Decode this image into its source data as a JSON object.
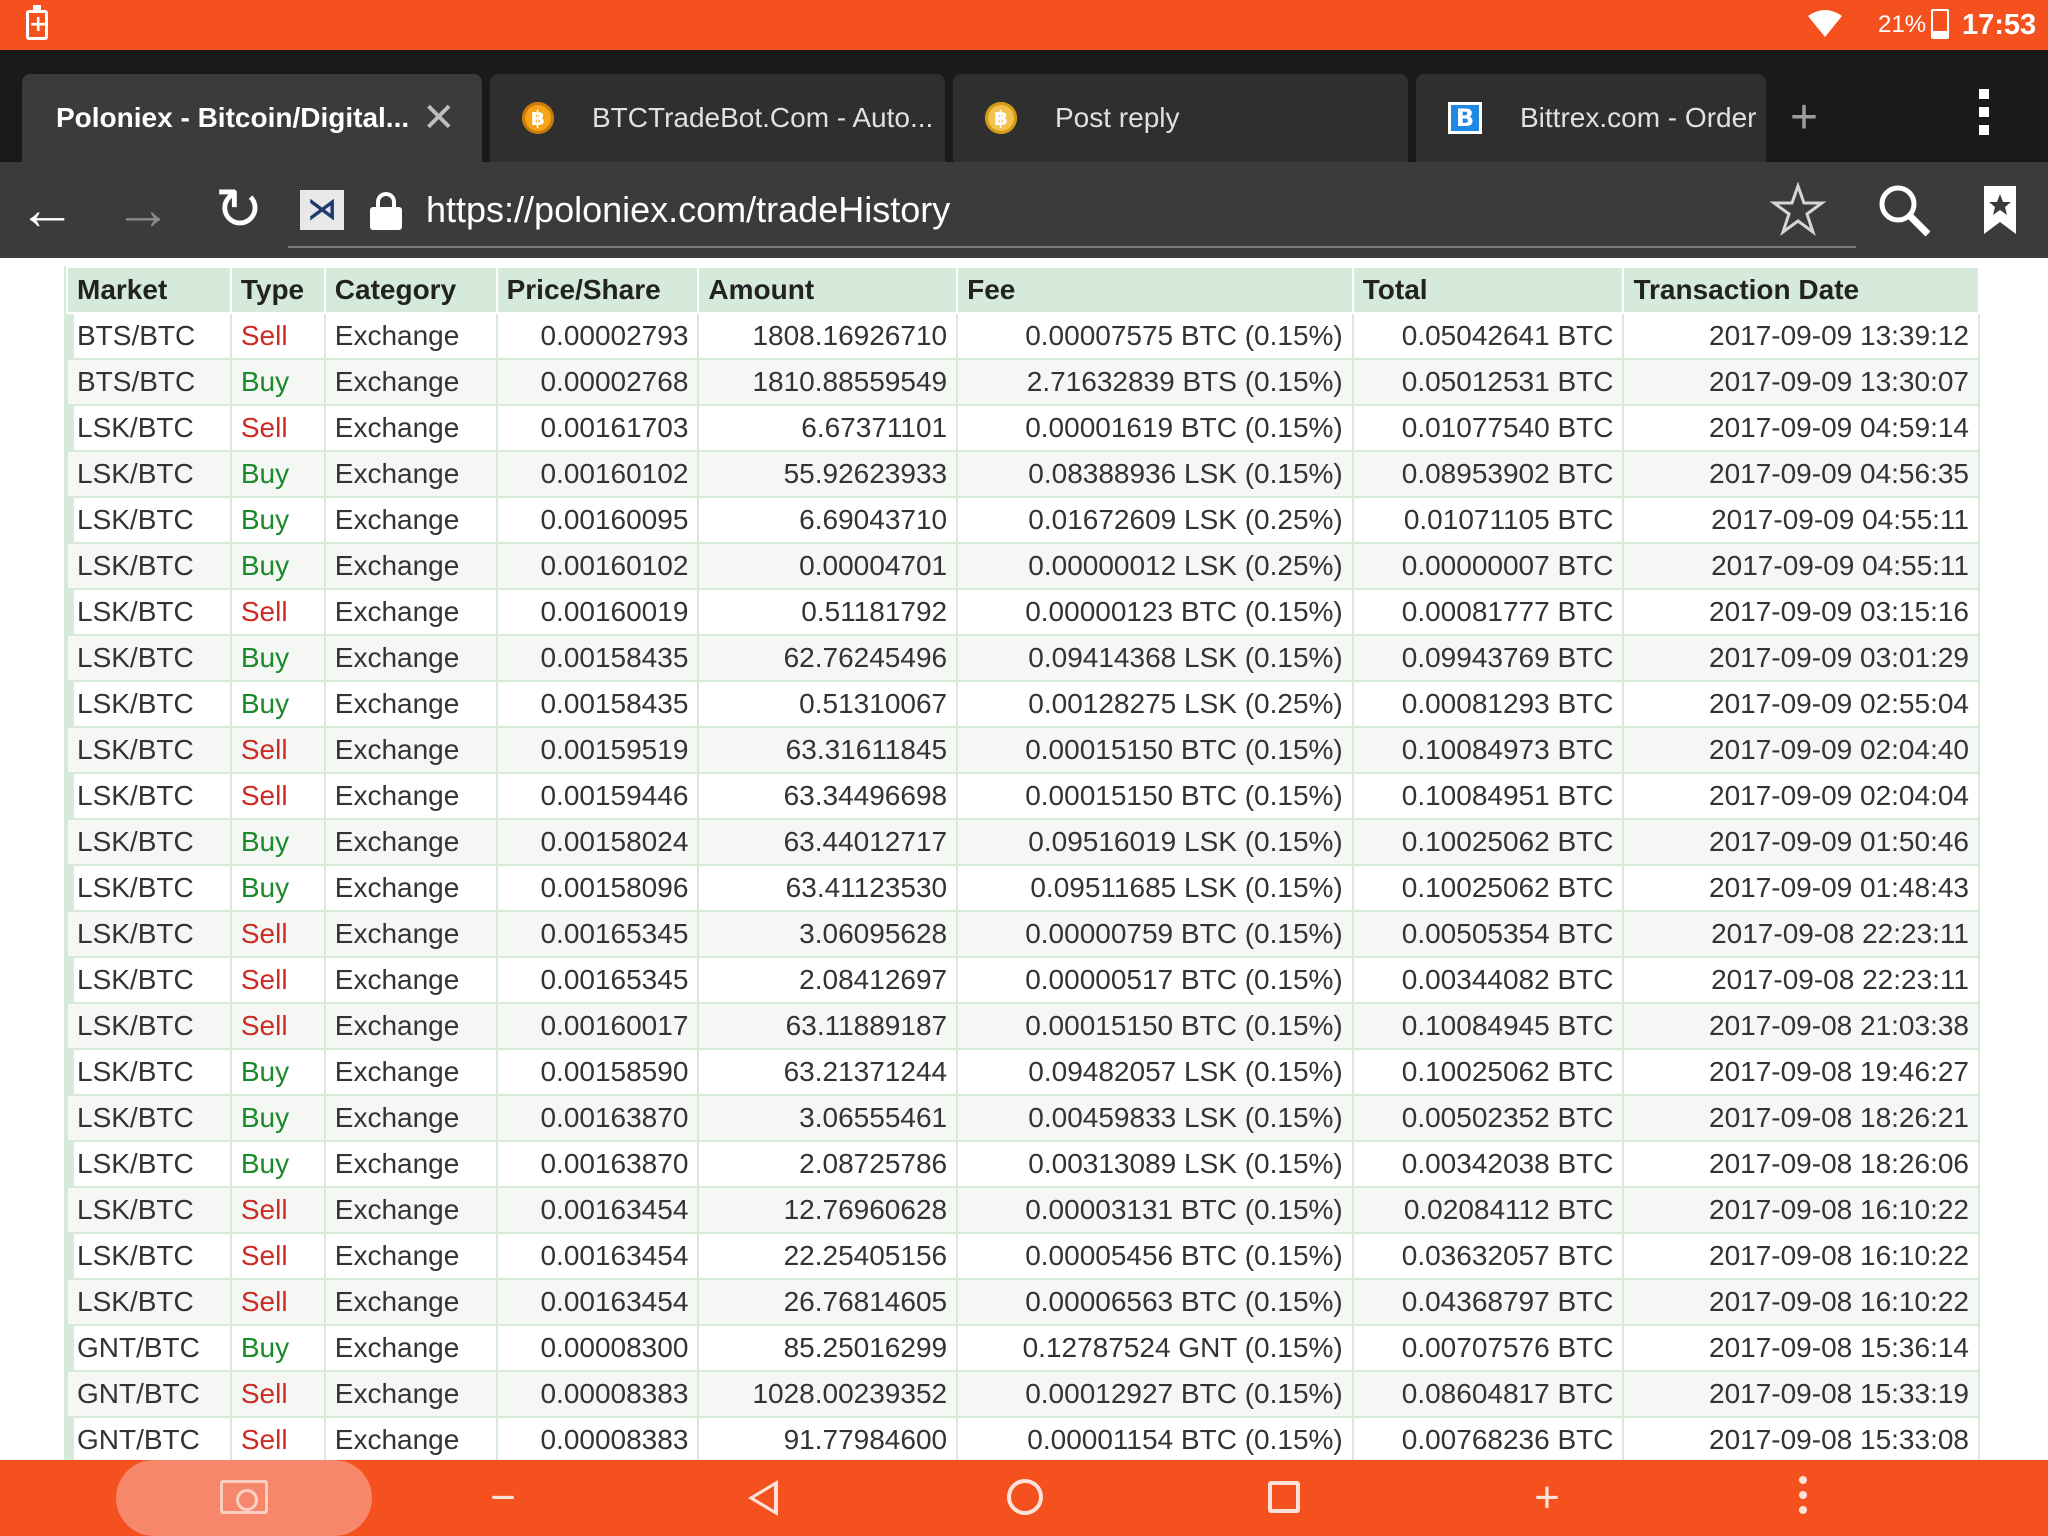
{
  "status_bar": {
    "battery_percent": "21%",
    "time": "17:53",
    "icons": [
      "battery-alert-icon",
      "wifi-icon",
      "battery-icon"
    ]
  },
  "tabs": [
    {
      "title": "Poloniex - Bitcoin/Digital...",
      "active": true,
      "close": "✕"
    },
    {
      "title": "BTCTradeBot.Com - Auto...",
      "favicon": "bitcoin-coin-icon"
    },
    {
      "title": "Post reply",
      "favicon": "bitcoin-coin-icon"
    },
    {
      "title": "Bittrex.com - Order I",
      "favicon": "bittrex-b-icon",
      "favicon_text": "B"
    }
  ],
  "toolbar": {
    "back": "←",
    "forward": "→",
    "reload": "↻",
    "site_icon_text": "⋊",
    "url": "https://poloniex.com/tradeHistory",
    "new_tab": "+"
  },
  "table": {
    "headers": [
      "Market",
      "Type",
      "Category",
      "Price/Share",
      "Amount",
      "Fee",
      "Total",
      "Transaction Date"
    ],
    "rows": [
      [
        "BTS/BTC",
        "Sell",
        "Exchange",
        "0.00002793",
        "1808.16926710",
        "0.00007575 BTC (0.15%)",
        "0.05042641 BTC",
        "2017-09-09 13:39:12"
      ],
      [
        "BTS/BTC",
        "Buy",
        "Exchange",
        "0.00002768",
        "1810.88559549",
        "2.71632839 BTS (0.15%)",
        "0.05012531 BTC",
        "2017-09-09 13:30:07"
      ],
      [
        "LSK/BTC",
        "Sell",
        "Exchange",
        "0.00161703",
        "6.67371101",
        "0.00001619 BTC (0.15%)",
        "0.01077540 BTC",
        "2017-09-09 04:59:14"
      ],
      [
        "LSK/BTC",
        "Buy",
        "Exchange",
        "0.00160102",
        "55.92623933",
        "0.08388936 LSK (0.15%)",
        "0.08953902 BTC",
        "2017-09-09 04:56:35"
      ],
      [
        "LSK/BTC",
        "Buy",
        "Exchange",
        "0.00160095",
        "6.69043710",
        "0.01672609 LSK (0.25%)",
        "0.01071105 BTC",
        "2017-09-09 04:55:11"
      ],
      [
        "LSK/BTC",
        "Buy",
        "Exchange",
        "0.00160102",
        "0.00004701",
        "0.00000012 LSK (0.25%)",
        "0.00000007 BTC",
        "2017-09-09 04:55:11"
      ],
      [
        "LSK/BTC",
        "Sell",
        "Exchange",
        "0.00160019",
        "0.51181792",
        "0.00000123 BTC (0.15%)",
        "0.00081777 BTC",
        "2017-09-09 03:15:16"
      ],
      [
        "LSK/BTC",
        "Buy",
        "Exchange",
        "0.00158435",
        "62.76245496",
        "0.09414368 LSK (0.15%)",
        "0.09943769 BTC",
        "2017-09-09 03:01:29"
      ],
      [
        "LSK/BTC",
        "Buy",
        "Exchange",
        "0.00158435",
        "0.51310067",
        "0.00128275 LSK (0.25%)",
        "0.00081293 BTC",
        "2017-09-09 02:55:04"
      ],
      [
        "LSK/BTC",
        "Sell",
        "Exchange",
        "0.00159519",
        "63.31611845",
        "0.00015150 BTC (0.15%)",
        "0.10084973 BTC",
        "2017-09-09 02:04:40"
      ],
      [
        "LSK/BTC",
        "Sell",
        "Exchange",
        "0.00159446",
        "63.34496698",
        "0.00015150 BTC (0.15%)",
        "0.10084951 BTC",
        "2017-09-09 02:04:04"
      ],
      [
        "LSK/BTC",
        "Buy",
        "Exchange",
        "0.00158024",
        "63.44012717",
        "0.09516019 LSK (0.15%)",
        "0.10025062 BTC",
        "2017-09-09 01:50:46"
      ],
      [
        "LSK/BTC",
        "Buy",
        "Exchange",
        "0.00158096",
        "63.41123530",
        "0.09511685 LSK (0.15%)",
        "0.10025062 BTC",
        "2017-09-09 01:48:43"
      ],
      [
        "LSK/BTC",
        "Sell",
        "Exchange",
        "0.00165345",
        "3.06095628",
        "0.00000759 BTC (0.15%)",
        "0.00505354 BTC",
        "2017-09-08 22:23:11"
      ],
      [
        "LSK/BTC",
        "Sell",
        "Exchange",
        "0.00165345",
        "2.08412697",
        "0.00000517 BTC (0.15%)",
        "0.00344082 BTC",
        "2017-09-08 22:23:11"
      ],
      [
        "LSK/BTC",
        "Sell",
        "Exchange",
        "0.00160017",
        "63.11889187",
        "0.00015150 BTC (0.15%)",
        "0.10084945 BTC",
        "2017-09-08 21:03:38"
      ],
      [
        "LSK/BTC",
        "Buy",
        "Exchange",
        "0.00158590",
        "63.21371244",
        "0.09482057 LSK (0.15%)",
        "0.10025062 BTC",
        "2017-09-08 19:46:27"
      ],
      [
        "LSK/BTC",
        "Buy",
        "Exchange",
        "0.00163870",
        "3.06555461",
        "0.00459833 LSK (0.15%)",
        "0.00502352 BTC",
        "2017-09-08 18:26:21"
      ],
      [
        "LSK/BTC",
        "Buy",
        "Exchange",
        "0.00163870",
        "2.08725786",
        "0.00313089 LSK (0.15%)",
        "0.00342038 BTC",
        "2017-09-08 18:26:06"
      ],
      [
        "LSK/BTC",
        "Sell",
        "Exchange",
        "0.00163454",
        "12.76960628",
        "0.00003131 BTC (0.15%)",
        "0.02084112 BTC",
        "2017-09-08 16:10:22"
      ],
      [
        "LSK/BTC",
        "Sell",
        "Exchange",
        "0.00163454",
        "22.25405156",
        "0.00005456 BTC (0.15%)",
        "0.03632057 BTC",
        "2017-09-08 16:10:22"
      ],
      [
        "LSK/BTC",
        "Sell",
        "Exchange",
        "0.00163454",
        "26.76814605",
        "0.00006563 BTC (0.15%)",
        "0.04368797 BTC",
        "2017-09-08 16:10:22"
      ],
      [
        "GNT/BTC",
        "Buy",
        "Exchange",
        "0.00008300",
        "85.25016299",
        "0.12787524 GNT (0.15%)",
        "0.00707576 BTC",
        "2017-09-08 15:36:14"
      ],
      [
        "GNT/BTC",
        "Sell",
        "Exchange",
        "0.00008383",
        "1028.00239352",
        "0.00012927 BTC (0.15%)",
        "0.08604817 BTC",
        "2017-09-08 15:33:19"
      ],
      [
        "GNT/BTC",
        "Sell",
        "Exchange",
        "0.00008383",
        "91.77984600",
        "0.00001154 BTC (0.15%)",
        "0.00768236 BTC",
        "2017-09-08 15:33:08"
      ]
    ]
  },
  "bottom_nav": {
    "icons": [
      "screenshot-camera-icon",
      "volume-down-icon",
      "back-icon",
      "home-icon",
      "recents-icon",
      "volume-up-icon",
      "more-icon"
    ],
    "minus": "−",
    "plus": "+"
  },
  "colors": {
    "system_accent": "#f4511e",
    "sell": "#cd2c24",
    "buy": "#1b8a2a",
    "table_header": "#d6eadb"
  }
}
